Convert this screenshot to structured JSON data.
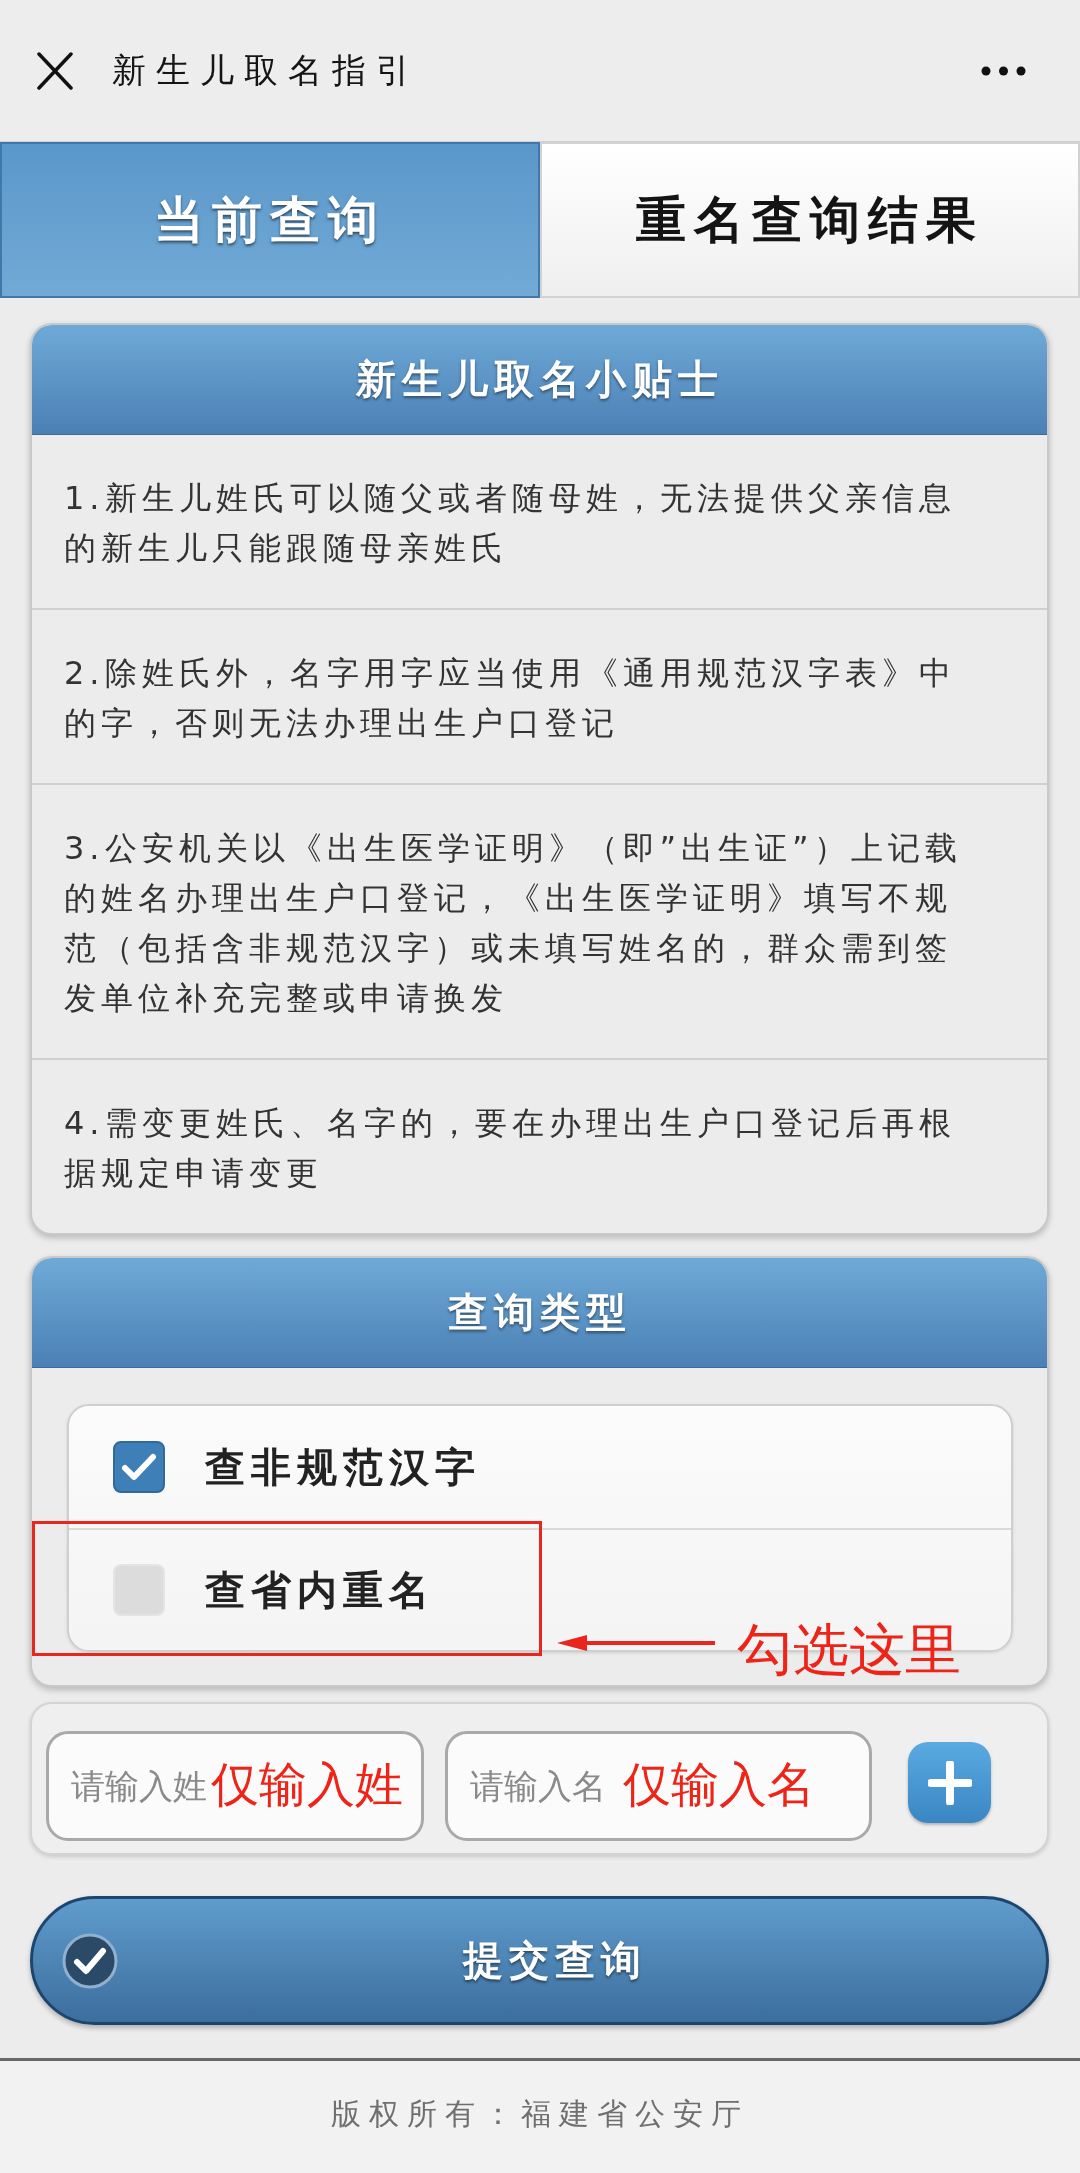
{
  "top_bar": {
    "title": "新生儿取名指引"
  },
  "tabs": [
    {
      "label": "当前查询",
      "selected": true
    },
    {
      "label": "重名查询结果",
      "selected": false
    }
  ],
  "tips_panel": {
    "title": "新生儿取名小贴士",
    "items": [
      "1.新生儿姓氏可以随父或者随母姓，无法提供父亲信息的新生儿只能跟随母亲姓氏",
      "2.除姓氏外，名字用字应当使用《通用规范汉字表》中的字，否则无法办理出生户口登记",
      "3.公安机关以《出生医学证明》（即”出生证”）上记载的姓名办理出生户口登记，《出生医学证明》填写不规范（包括含非规范汉字）或未填写姓名的，群众需到签发单位补充完整或申请换发",
      "4.需变更姓氏、名字的，要在办理出生户口登记后再根据规定申请变更"
    ]
  },
  "query_type_panel": {
    "title": "查询类型",
    "options": [
      {
        "label": "查非规范汉字",
        "checked": true
      },
      {
        "label": "查省内重名",
        "checked": false,
        "annotation": "勾选这里"
      }
    ]
  },
  "name_inputs": [
    {
      "placeholder": "请输入姓",
      "annotation": "仅输入姓"
    },
    {
      "placeholder": "请输入名",
      "annotation": "仅输入名"
    }
  ],
  "submit_button": {
    "label": "提交查询"
  },
  "footer": {
    "copyright": "版权所有：福建省公安厅"
  }
}
